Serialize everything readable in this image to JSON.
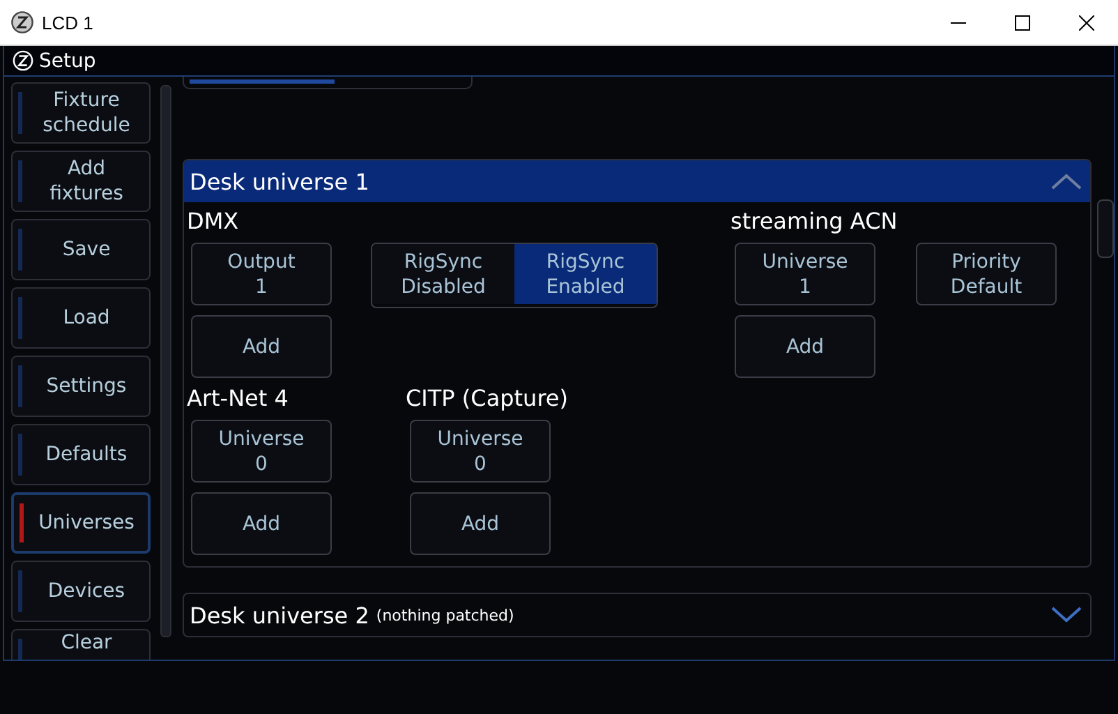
{
  "window": {
    "title": "LCD 1"
  },
  "header": {
    "title": "Setup"
  },
  "sidebar": {
    "items": [
      {
        "label": "Fixture schedule",
        "selected": false
      },
      {
        "label": "Add fixtures",
        "selected": false
      },
      {
        "label": "Save",
        "selected": false
      },
      {
        "label": "Load",
        "selected": false
      },
      {
        "label": "Settings",
        "selected": false
      },
      {
        "label": "Defaults",
        "selected": false
      },
      {
        "label": "Universes",
        "selected": true
      },
      {
        "label": "Devices",
        "selected": false
      },
      {
        "label": "Clear",
        "selected": false
      }
    ]
  },
  "panels": [
    {
      "title": "Desk universe 1",
      "expanded": true,
      "sections": [
        {
          "title": "DMX",
          "kind": "dmx",
          "buttons": [
            {
              "label": "Output\n1"
            },
            {
              "label": "Add"
            }
          ],
          "toggle": [
            {
              "label": "RigSync\nDisabled",
              "selected": false
            },
            {
              "label": "RigSync\nEnabled",
              "selected": true
            }
          ]
        },
        {
          "title": "streaming ACN",
          "kind": "sacn",
          "buttons": [
            {
              "label": "Universe\n1"
            },
            {
              "label": "Add"
            }
          ],
          "extra": {
            "label": "Priority\nDefault"
          }
        },
        {
          "title": "Art-Net 4",
          "kind": "plain",
          "buttons": [
            {
              "label": "Universe\n0"
            },
            {
              "label": "Add"
            }
          ]
        },
        {
          "title": "CITP (Capture)",
          "kind": "plain",
          "buttons": [
            {
              "label": "Universe\n0"
            },
            {
              "label": "Add"
            }
          ]
        }
      ]
    },
    {
      "title": "Desk universe 2",
      "note": "(nothing patched)",
      "expanded": false
    }
  ]
}
